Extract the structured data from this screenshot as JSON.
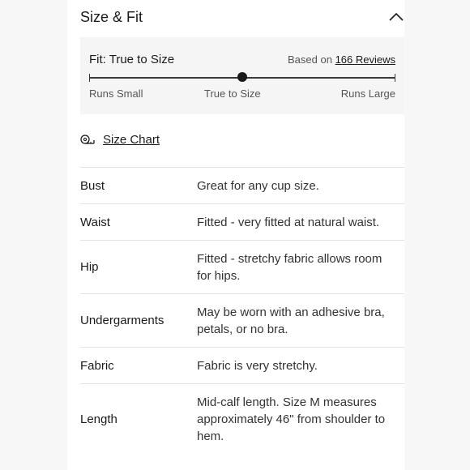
{
  "header": {
    "title": "Size & Fit"
  },
  "fit": {
    "label": "Fit: True to Size",
    "based_on_prefix": "Based on",
    "reviews_link": "166 Reviews",
    "scale": {
      "left": "Runs Small",
      "middle": "True to Size",
      "right": "Runs Large"
    },
    "position_fraction": 0.5
  },
  "size_chart": {
    "label": "Size Chart"
  },
  "details": [
    {
      "key": "Bust",
      "value": "Great for any cup size."
    },
    {
      "key": "Waist",
      "value": "Fitted - very fitted at natural waist."
    },
    {
      "key": "Hip",
      "value": "Fitted - stretchy fabric allows room for hips."
    },
    {
      "key": "Undergarments",
      "value": "May be worn with an adhesive bra, petals, or no bra."
    },
    {
      "key": "Fabric",
      "value": "Fabric is very stretchy."
    },
    {
      "key": "Length",
      "value": "Mid-calf length. Size M measures approximately 46\" from shoulder to hem."
    }
  ]
}
